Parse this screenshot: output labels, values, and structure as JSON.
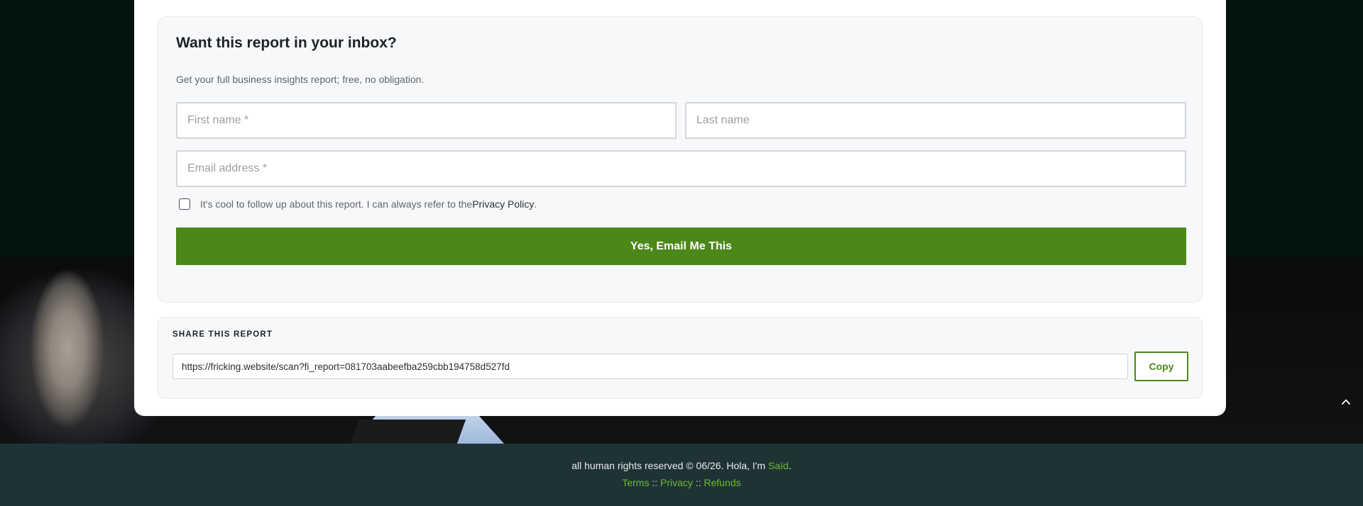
{
  "form": {
    "title": "Want this report in your inbox?",
    "subtitle": "Get your full business insights report; free, no obligation.",
    "first_name_placeholder": "First name *",
    "last_name_placeholder": "Last name",
    "email_placeholder": "Email address *",
    "consent_text": "It's cool to follow up about this report. I can always refer to the ",
    "consent_link": "Privacy Policy",
    "consent_end": ".",
    "submit_label": "Yes, Email Me This"
  },
  "share": {
    "label": "SHARE THIS REPORT",
    "url": "https://fricking.website/scan?fi_report=081703aabeefba259cbb194758d527fd",
    "copy_label": "Copy"
  },
  "footer": {
    "rights_text": "all human rights reserved © 06/26. Hola, I'm ",
    "author_name": "Saïd",
    "rights_end": ".",
    "links": [
      "Terms",
      "Privacy",
      "Refunds"
    ],
    "separator": "::"
  },
  "colors": {
    "accent": "#4c8719",
    "footer_link": "#6fbb2e",
    "footer_bg": "#1f3336"
  },
  "icons": {
    "scroll_top": "chevron-up-icon"
  }
}
